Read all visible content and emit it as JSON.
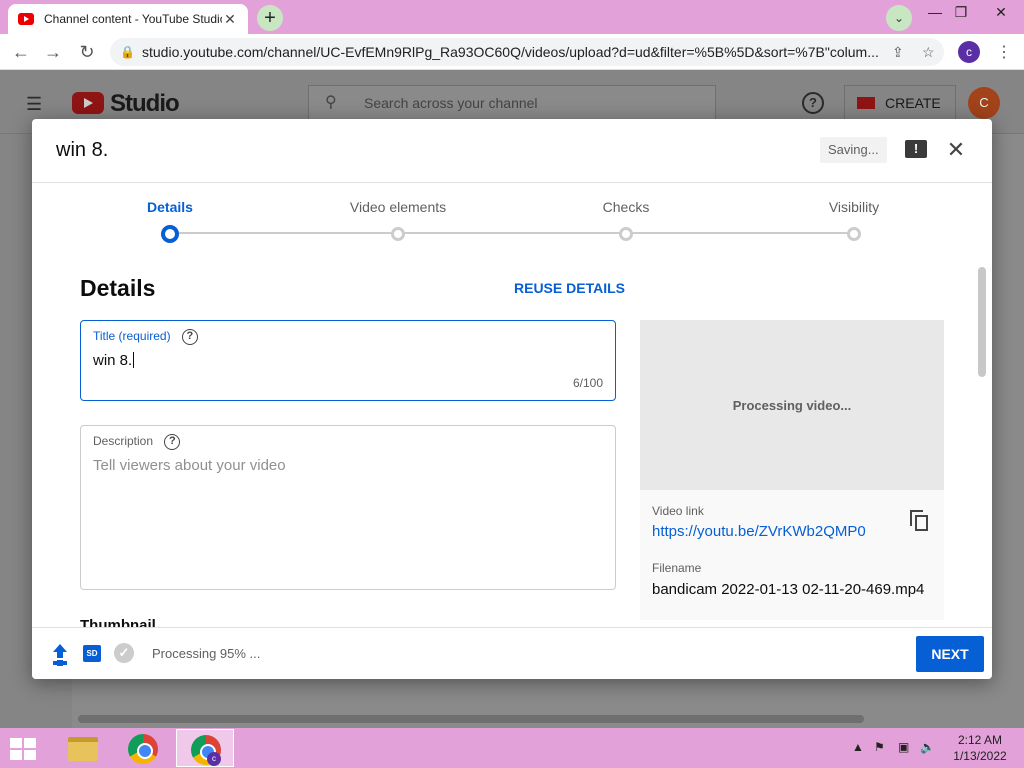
{
  "browser": {
    "tab_title": "Channel content - YouTube Studio",
    "tab_close": "✕",
    "new_tab": "+",
    "url": "studio.youtube.com/channel/UC-EvfEMn9RlPg_Ra93OC60Q/videos/upload?d=ud&filter=%5B%5D&sort=%7B\"colum...",
    "profile_initial": "c",
    "window_controls": [
      "—",
      "❐",
      "✕"
    ]
  },
  "studio": {
    "brand": "Studio",
    "search_placeholder": "Search across your channel",
    "create_label": "CREATE",
    "avatar_initial": "C"
  },
  "dialog": {
    "title": "win 8.",
    "saving": "Saving...",
    "steps": [
      {
        "label": "Details",
        "active": true
      },
      {
        "label": "Video elements",
        "active": false
      },
      {
        "label": "Checks",
        "active": false
      },
      {
        "label": "Visibility",
        "active": false
      }
    ],
    "section_title": "Details",
    "reuse_details": "REUSE DETAILS",
    "title_field": {
      "label": "Title (required)",
      "value": "win 8.",
      "count": "6/100"
    },
    "description_field": {
      "label": "Description",
      "placeholder": "Tell viewers about your video"
    },
    "thumbnail_title": "Thumbnail",
    "preview": {
      "processing": "Processing video...",
      "video_link_label": "Video link",
      "video_link": "https://youtu.be/ZVrKWb2QMP0",
      "filename_label": "Filename",
      "filename": "bandicam 2022-01-13 02-11-20-469.mp4"
    },
    "footer": {
      "sd_badge": "SD",
      "processing_status": "Processing 95% ...",
      "processing_progress": 0.95,
      "next_label": "NEXT"
    }
  },
  "taskbar": {
    "time": "2:12 AM",
    "date": "1/13/2022"
  },
  "colors": {
    "accent": "#065fd4",
    "youtube_red": "#ff0000",
    "taskbar": "#e2a2d9"
  }
}
